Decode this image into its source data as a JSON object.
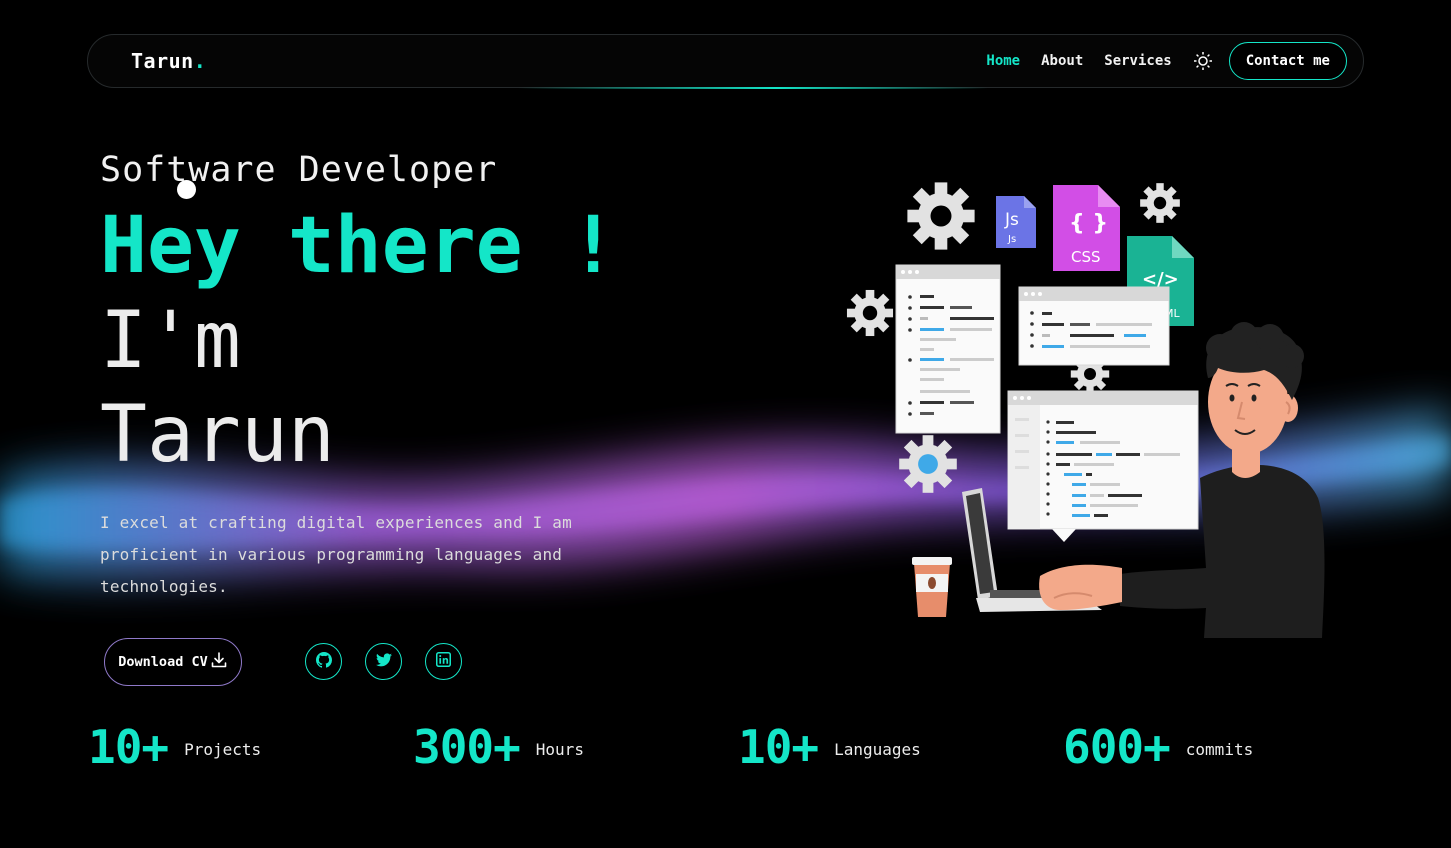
{
  "brand": {
    "name": "Tarun",
    "dot": "."
  },
  "nav": {
    "links": [
      {
        "label": "Home",
        "active": true
      },
      {
        "label": "About",
        "active": false
      },
      {
        "label": "Services",
        "active": false
      }
    ],
    "theme_icon": "sun-icon",
    "contact_label": "Contact me"
  },
  "hero": {
    "subtitle": "Software Developer",
    "greeting": "Hey there !",
    "intro": "I'm",
    "name": "Tarun",
    "description": "I excel at crafting digital experiences and I am proficient in various programming languages and technologies.",
    "download_label": "Download CV",
    "download_icon": "download-icon",
    "socials": [
      {
        "name": "github",
        "icon": "github-icon"
      },
      {
        "name": "twitter",
        "icon": "twitter-icon"
      },
      {
        "name": "linkedin",
        "icon": "linkedin-icon"
      }
    ]
  },
  "illustration": {
    "file_js_label": "Js",
    "file_js_sub": "Js",
    "file_css_icon": "{ }",
    "file_css_label": "CSS",
    "file_html_icon": "</>",
    "file_html_label": "ML"
  },
  "stats": [
    {
      "value": "10+",
      "label": "Projects"
    },
    {
      "value": "300+",
      "label": "Hours"
    },
    {
      "value": "10+",
      "label": "Languages"
    },
    {
      "value": "600+",
      "label": "commits"
    }
  ],
  "colors": {
    "accent": "#14e6c8",
    "background": "#000000",
    "button_border": "#8f79c9"
  }
}
